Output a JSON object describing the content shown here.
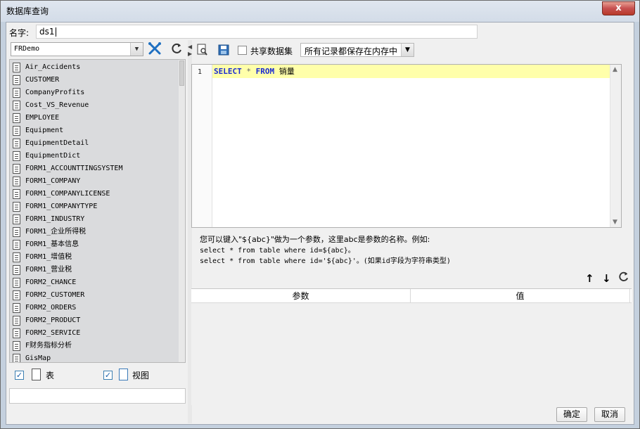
{
  "window": {
    "title": "数据库查询",
    "close_label": "x"
  },
  "name_field": {
    "label": "名字:",
    "value": "ds1"
  },
  "left_panel": {
    "connection": "FRDemo",
    "tables": [
      "Air_Accidents",
      "CUSTOMER",
      "CompanyProfits",
      "Cost_VS_Revenue",
      "EMPLOYEE",
      "Equipment",
      "EquipmentDetail",
      "EquipmentDict",
      "FORM1_ACCOUNTTINGSYSTEM",
      "FORM1_COMPANY",
      "FORM1_COMPANYLICENSE",
      "FORM1_COMPANYTYPE",
      "FORM1_INDUSTRY",
      "FORM1_企业所得税",
      "FORM1_基本信息",
      "FORM1_增值税",
      "FORM1_营业税",
      "FORM2_CHANCE",
      "FORM2_CUSTOMER",
      "FORM2_ORDERS",
      "FORM2_PRODUCT",
      "FORM2_SERVICE",
      "F财务指标分析",
      "GisMap"
    ],
    "show_tables_label": "表",
    "show_views_label": "视图"
  },
  "right_panel": {
    "share_label": "共享数据集",
    "storage_option": "所有记录都保存在内存中",
    "sql": {
      "line_number": "1",
      "kw_select": "SELECT",
      "star": "*",
      "kw_from": "FROM",
      "table": "销量"
    },
    "help": {
      "line1": "您可以键入\"${abc}\"做为一个参数，这里abc是参数的名称。例如:",
      "line2": "select * from table where id=${abc}。",
      "line3": "select * from table where id='${abc}'。(如果id字段为字符串类型)"
    },
    "param_columns": [
      "参数",
      "值"
    ]
  },
  "footer": {
    "ok_label": "确定",
    "cancel_label": "取消"
  }
}
